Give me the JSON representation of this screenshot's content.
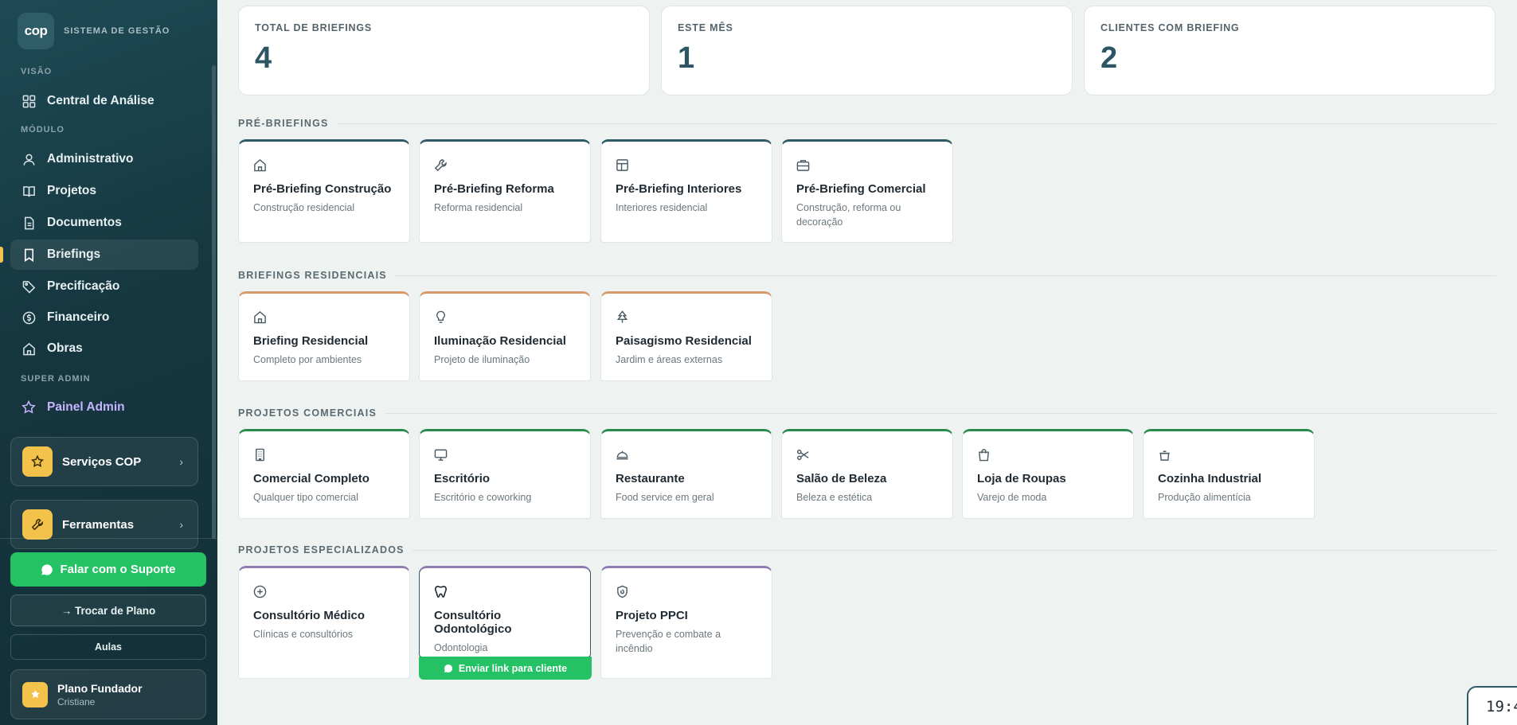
{
  "brand": {
    "logo": "cop",
    "name": "SISTEMA DE GESTÃO"
  },
  "sidebar": {
    "sections": {
      "visao": "VISÃO",
      "modulo": "MÓDULO",
      "super_admin": "SUPER ADMIN"
    },
    "central": {
      "label": "Central de Análise",
      "icon": "grid-icon"
    },
    "items": [
      {
        "label": "Administrativo",
        "icon": "user-icon"
      },
      {
        "label": "Projetos",
        "icon": "book-icon"
      },
      {
        "label": "Documentos",
        "icon": "document-icon"
      },
      {
        "label": "Briefings",
        "icon": "bookmark-icon",
        "active": true
      },
      {
        "label": "Precificação",
        "icon": "tag-icon"
      },
      {
        "label": "Financeiro",
        "icon": "coin-icon"
      },
      {
        "label": "Obras",
        "icon": "home-icon"
      }
    ],
    "admin": {
      "label": "Painel Admin",
      "icon": "star-icon"
    },
    "cards": [
      {
        "label": "Serviços COP",
        "icon": "star-icon"
      },
      {
        "label": "Ferramentas",
        "icon": "wrench-icon"
      }
    ],
    "support": "Falar com o Suporte",
    "swap": "→  Trocar de Plano",
    "aulas": "Aulas",
    "plan": {
      "name": "Plano Fundador",
      "user": "Cristiane"
    }
  },
  "stats": [
    {
      "label": "TOTAL DE BRIEFINGS",
      "value": "4"
    },
    {
      "label": "ESTE MÊS",
      "value": "1"
    },
    {
      "label": "CLIENTES COM BRIEFING",
      "value": "2"
    }
  ],
  "sections": {
    "pre": {
      "title": "PRÉ-BRIEFINGS",
      "items": [
        {
          "title": "Pré-Briefing Construção",
          "desc": "Construção residencial",
          "icon": "home-icon"
        },
        {
          "title": "Pré-Briefing Reforma",
          "desc": "Reforma residencial",
          "icon": "wrench-icon"
        },
        {
          "title": "Pré-Briefing Interiores",
          "desc": "Interiores residencial",
          "icon": "layout-icon"
        },
        {
          "title": "Pré-Briefing Comercial",
          "desc": "Construção, reforma ou decoração",
          "icon": "briefcase-icon"
        }
      ]
    },
    "res": {
      "title": "BRIEFINGS RESIDENCIAIS",
      "items": [
        {
          "title": "Briefing Residencial",
          "desc": "Completo por ambientes",
          "icon": "home-icon"
        },
        {
          "title": "Iluminação Residencial",
          "desc": "Projeto de iluminação",
          "icon": "bulb-icon"
        },
        {
          "title": "Paisagismo Residencial",
          "desc": "Jardim e áreas externas",
          "icon": "tree-icon"
        }
      ]
    },
    "com": {
      "title": "PROJETOS COMERCIAIS",
      "items": [
        {
          "title": "Comercial Completo",
          "desc": "Qualquer tipo comercial",
          "icon": "building-icon"
        },
        {
          "title": "Escritório",
          "desc": "Escritório e coworking",
          "icon": "monitor-icon"
        },
        {
          "title": "Restaurante",
          "desc": "Food service em geral",
          "icon": "cloche-icon"
        },
        {
          "title": "Salão de Beleza",
          "desc": "Beleza e estética",
          "icon": "scissors-icon"
        },
        {
          "title": "Loja de Roupas",
          "desc": "Varejo de moda",
          "icon": "shopping-bag-icon"
        },
        {
          "title": "Cozinha Industrial",
          "desc": "Produção alimentícia",
          "icon": "pot-icon"
        }
      ]
    },
    "esp": {
      "title": "PROJETOS ESPECIALIZADOS",
      "items": [
        {
          "title": "Consultório Médico",
          "desc": "Clínicas e consultórios",
          "icon": "plus-circle-icon"
        },
        {
          "title": "Consultório Odontológico",
          "desc": "Odontologia",
          "icon": "tooth-icon"
        },
        {
          "title": "Projeto PPCI",
          "desc": "Prevenção e combate a incêndio",
          "icon": "shield-fire-icon"
        }
      ]
    }
  },
  "send_link": "Enviar link para cliente",
  "clock": "19:4",
  "colors": {
    "accent_teal": "#2f5a66",
    "orange": "#d69a6a",
    "green": "#2a8a4e",
    "purple": "#8e7bb0",
    "whatsapp": "#25c165",
    "gold": "#f2c24b"
  }
}
